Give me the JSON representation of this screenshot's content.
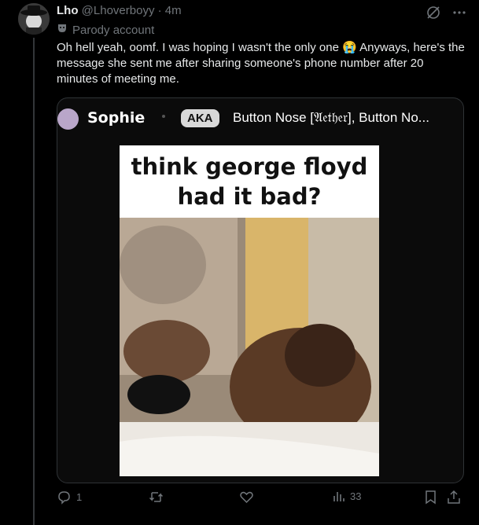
{
  "post": {
    "display_name": "Lho",
    "handle": "@Lhoverboyy",
    "separator": "·",
    "time": "4m",
    "badge_label": "Parody account",
    "text": "Oh hell yeah, oomf. I was hoping I wasn't the only one 😭 Anyways, here's the message she sent me after sharing someone's phone number after 20 minutes of meeting me."
  },
  "embedded": {
    "name": "Sophie",
    "aka_label": "AKA",
    "aliases": "Button Nose [𝔄𝔢𝔱𝔥𝔢𝔯], Button No...",
    "caption_line1": "think george floyd",
    "caption_line2": "had it bad?"
  },
  "actions": {
    "reply_count": "1",
    "repost_count": "",
    "like_count": "",
    "views_count": "33"
  },
  "icons": [
    "avatar",
    "parody-mask-icon",
    "grok-icon",
    "more-icon",
    "reply-icon",
    "repost-icon",
    "like-icon",
    "views-icon",
    "bookmark-icon",
    "share-icon"
  ],
  "colors": {
    "background": "#000000",
    "text": "#e7e9ea",
    "muted": "#71767b",
    "border": "#2f3336"
  }
}
